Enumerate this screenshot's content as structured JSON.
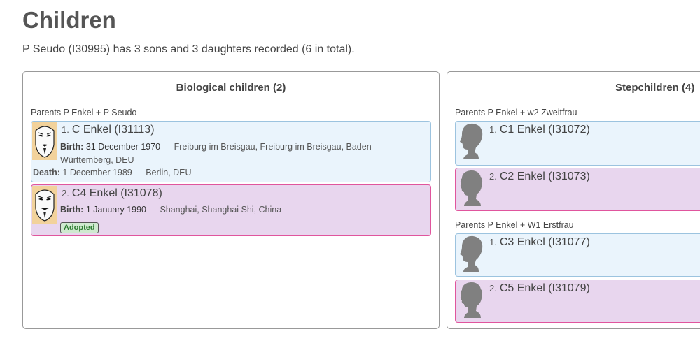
{
  "page": {
    "title": "Children",
    "summary": "P Seudo (I30995) has 3 sons and 3 daughters recorded (6 in total)."
  },
  "biological": {
    "title": "Biological children (2)",
    "parents_label": "Parents P Enkel + P Seudo",
    "children": [
      {
        "index": "1.",
        "name": "C Enkel (I31113)",
        "sex": "male",
        "photo": "anonymous-mask",
        "birth_label": "Birth:",
        "birth_date": "31 December 1970",
        "birth_place_line1": " — Freiburg im Breisgau, Freiburg im Breisgau, Baden-",
        "birth_place_line2": "Württemberg, DEU",
        "death_label": "Death:",
        "death_date": "1 December 1989",
        "death_place": " — Berlin, DEU"
      },
      {
        "index": "2.",
        "name": "C4 Enkel (I31078)",
        "sex": "female",
        "photo": "anonymous-mask",
        "birth_label": "Birth:",
        "birth_date": "1 January 1990",
        "birth_place": " — Shanghai, Shanghai Shi, China",
        "badge": "Adopted"
      }
    ]
  },
  "step": {
    "title": "Stepchildren (4)",
    "groups": [
      {
        "parents_label": "Parents P Enkel + w2 Zweitfrau",
        "children": [
          {
            "index": "1.",
            "name": "C1 Enkel (I31072)",
            "sex": "male",
            "photo": "male-silhouette"
          },
          {
            "index": "2.",
            "name": "C2 Enkel (I31073)",
            "sex": "female",
            "photo": "female-silhouette"
          }
        ]
      },
      {
        "parents_label": "Parents P Enkel + W1 Erstfrau",
        "children": [
          {
            "index": "1.",
            "name": "C3 Enkel (I31077)",
            "sex": "male",
            "photo": "male-silhouette"
          },
          {
            "index": "2.",
            "name": "C5 Enkel (I31079)",
            "sex": "female",
            "photo": "female-silhouette"
          }
        ]
      }
    ]
  },
  "colors": {
    "male_card_bg": "#eaf4fc",
    "female_card_bg": "#e8d6ee",
    "female_border": "#e0559d",
    "adopted_badge_text": "#2e7d32"
  }
}
